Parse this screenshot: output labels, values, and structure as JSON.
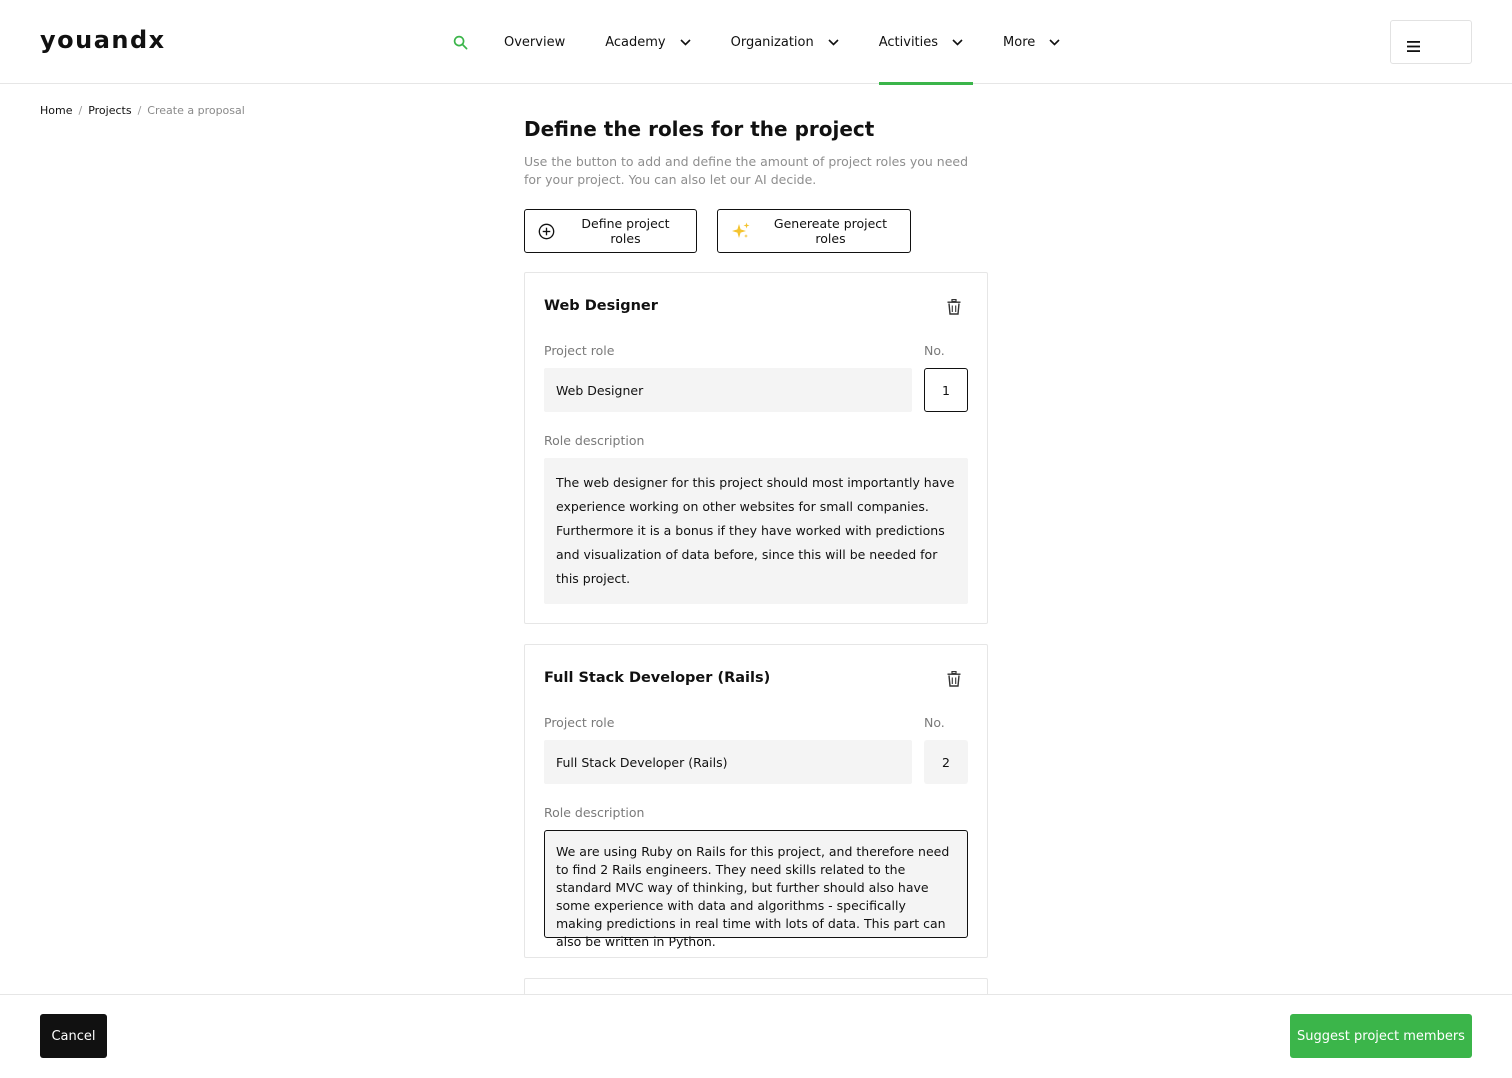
{
  "app": {
    "logo": "youandx",
    "accent_color": "#3bb54a"
  },
  "nav": {
    "search_icon": "search-icon",
    "items": [
      {
        "label": "Overview",
        "has_dropdown": false,
        "active": false
      },
      {
        "label": "Academy",
        "has_dropdown": true,
        "active": false
      },
      {
        "label": "Organization",
        "has_dropdown": true,
        "active": false
      },
      {
        "label": "Activities",
        "has_dropdown": true,
        "active": true
      },
      {
        "label": "More",
        "has_dropdown": true,
        "active": false
      }
    ],
    "menu_icon": "hamburger-menu-icon"
  },
  "breadcrumb": {
    "home": "Home",
    "projects": "Projects",
    "current": "Create a proposal"
  },
  "main": {
    "title": "Define the roles for the project",
    "subtitle": "Use the button to add and define the amount of project roles you need for your project. You can also let our AI decide.",
    "define_button": "Define project roles",
    "generate_button": "Genereate project roles"
  },
  "roles": [
    {
      "title": "Web Designer",
      "role_label": "Project role",
      "role_value": "Web Designer",
      "count_label": "No.",
      "count": "1",
      "description_label": "Role description",
      "description": "The web designer for this project should most importantly have experience working on other websites for small companies. Furthermore it is a bonus if they have worked with predictions and visualization of data before, since this will be needed for this project."
    },
    {
      "title": "Full Stack Developer (Rails)",
      "role_label": "Project role",
      "role_value": "Full Stack Developer (Rails)",
      "count_label": "No.",
      "count": "2",
      "description_label": "Role description",
      "description": "We are using Ruby on Rails for this project, and therefore need to find 2 Rails engineers. They need skills related to the standard MVC way of thinking, but further should also have some experience with data and algorithms - specifically making predictions in real time with lots of data. This part can also be written in Python."
    }
  ],
  "footer": {
    "cancel": "Cancel",
    "suggest": "Suggest project members"
  }
}
